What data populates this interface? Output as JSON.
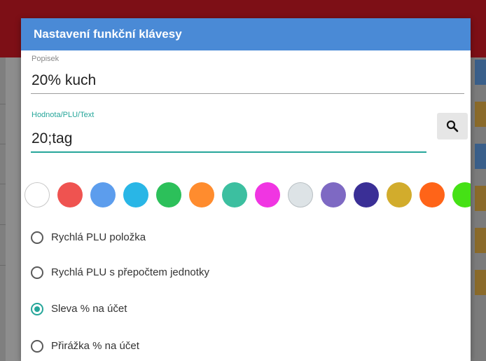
{
  "dialog": {
    "title": "Nastavení funkční klávesy"
  },
  "fields": {
    "description": {
      "label": "Popisek",
      "value": "20% kuch"
    },
    "value": {
      "label": "Hodnota/PLU/Text",
      "value": "20;tag"
    }
  },
  "search_button": {
    "icon": "search-icon"
  },
  "colors": [
    "#ffffff",
    "#ef5350",
    "#5c9ded",
    "#29b6e6",
    "#2cc05a",
    "#ff8c2e",
    "#3cbfa0",
    "#f035e2",
    "#dde3e6",
    "#7e69c3",
    "#3a2f96",
    "#d2ac2c",
    "#ff6418",
    "#45e115"
  ],
  "options": [
    {
      "label": "Rychlá PLU položka",
      "checked": false
    },
    {
      "label": "Rychlá PLU s přepočtem jednotky",
      "checked": false
    },
    {
      "label": "Sleva % na účet",
      "checked": true
    },
    {
      "label": "Přirážka % na účet",
      "checked": false
    }
  ],
  "accent_color": "#26a69a",
  "header_color": "#4a8ad6"
}
